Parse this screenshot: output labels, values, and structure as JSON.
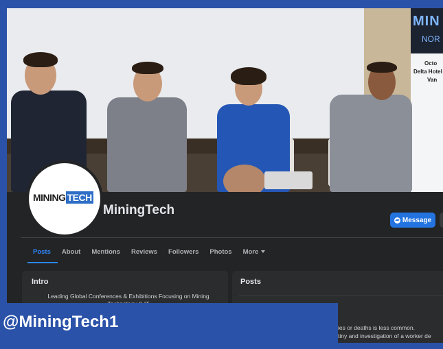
{
  "cover": {
    "banner_line1": "MIN",
    "banner_line2": "NOR",
    "banner_line3": "Octo",
    "banner_line4": "Delta Hotel",
    "banner_line5": "Van"
  },
  "profile": {
    "logo_part1": "MINING",
    "logo_part2": "TECH",
    "page_name": "MiningTech"
  },
  "actions": {
    "message_label": "Message"
  },
  "tabs": [
    {
      "label": "Posts"
    },
    {
      "label": "About"
    },
    {
      "label": "Mentions"
    },
    {
      "label": "Reviews"
    },
    {
      "label": "Followers"
    },
    {
      "label": "Photos"
    },
    {
      "label": "More"
    }
  ],
  "intro": {
    "title": "Intro",
    "text": "Leading Global Conferences & Exhibitions Focusing on Mining Technology & IT"
  },
  "posts": {
    "title": "Posts",
    "line1": "ies or deaths is less common.",
    "line2": "tiny and investigation of a worker de"
  },
  "handle": {
    "text": "@MiningTech1"
  },
  "colors": {
    "accent": "#2374e1",
    "brand_blue": "#2a52a8",
    "tab_active": "#2d88ff"
  }
}
